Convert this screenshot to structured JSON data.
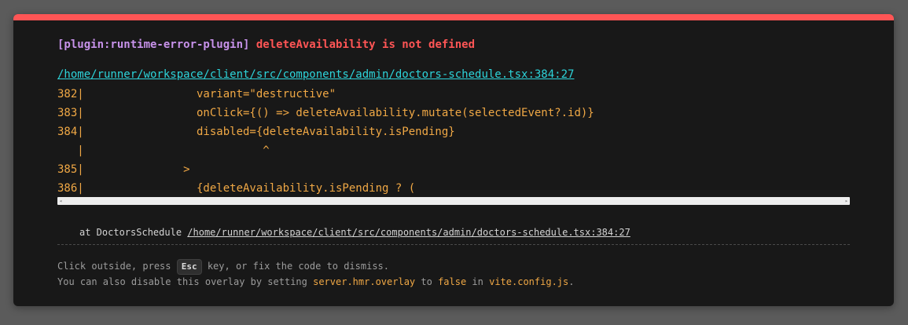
{
  "error": {
    "plugin": "[plugin:runtime-error-plugin]",
    "message": "deleteAvailability is not defined",
    "file": "/home/runner/workspace/client/src/components/admin/doctors-schedule.tsx:384:27"
  },
  "code_frame": [
    "382|                 variant=\"destructive\"",
    "383|                 onClick={() => deleteAvailability.mutate(selectedEvent?.id)}",
    "384|                 disabled={deleteAvailability.isPending}",
    "   |                           ^",
    "385|               >",
    "386|                 {deleteAvailability.isPending ? ("
  ],
  "scrollbar": {
    "left_arrow": "◂",
    "right_arrow": "▸"
  },
  "stack": {
    "prefix": "at DoctorsSchedule ",
    "file": "/home/runner/workspace/client/src/components/admin/doctors-schedule.tsx:384:27"
  },
  "tip": {
    "line1_before": "Click outside, press ",
    "key": "Esc",
    "line1_after": " key, or fix the code to dismiss.",
    "line2_before": "You can also disable this overlay by setting ",
    "line2_code1": "server.hmr.overlay",
    "line2_mid1": " to ",
    "line2_code2": "false",
    "line2_mid2": " in ",
    "line2_code3": "vite.config.js",
    "line2_end": "."
  },
  "colors": {
    "accent_top_border": "#ff5555",
    "plugin": "#c792ea",
    "error": "#ff5555",
    "file_link": "#2dd4da",
    "code": "#f0a845"
  }
}
